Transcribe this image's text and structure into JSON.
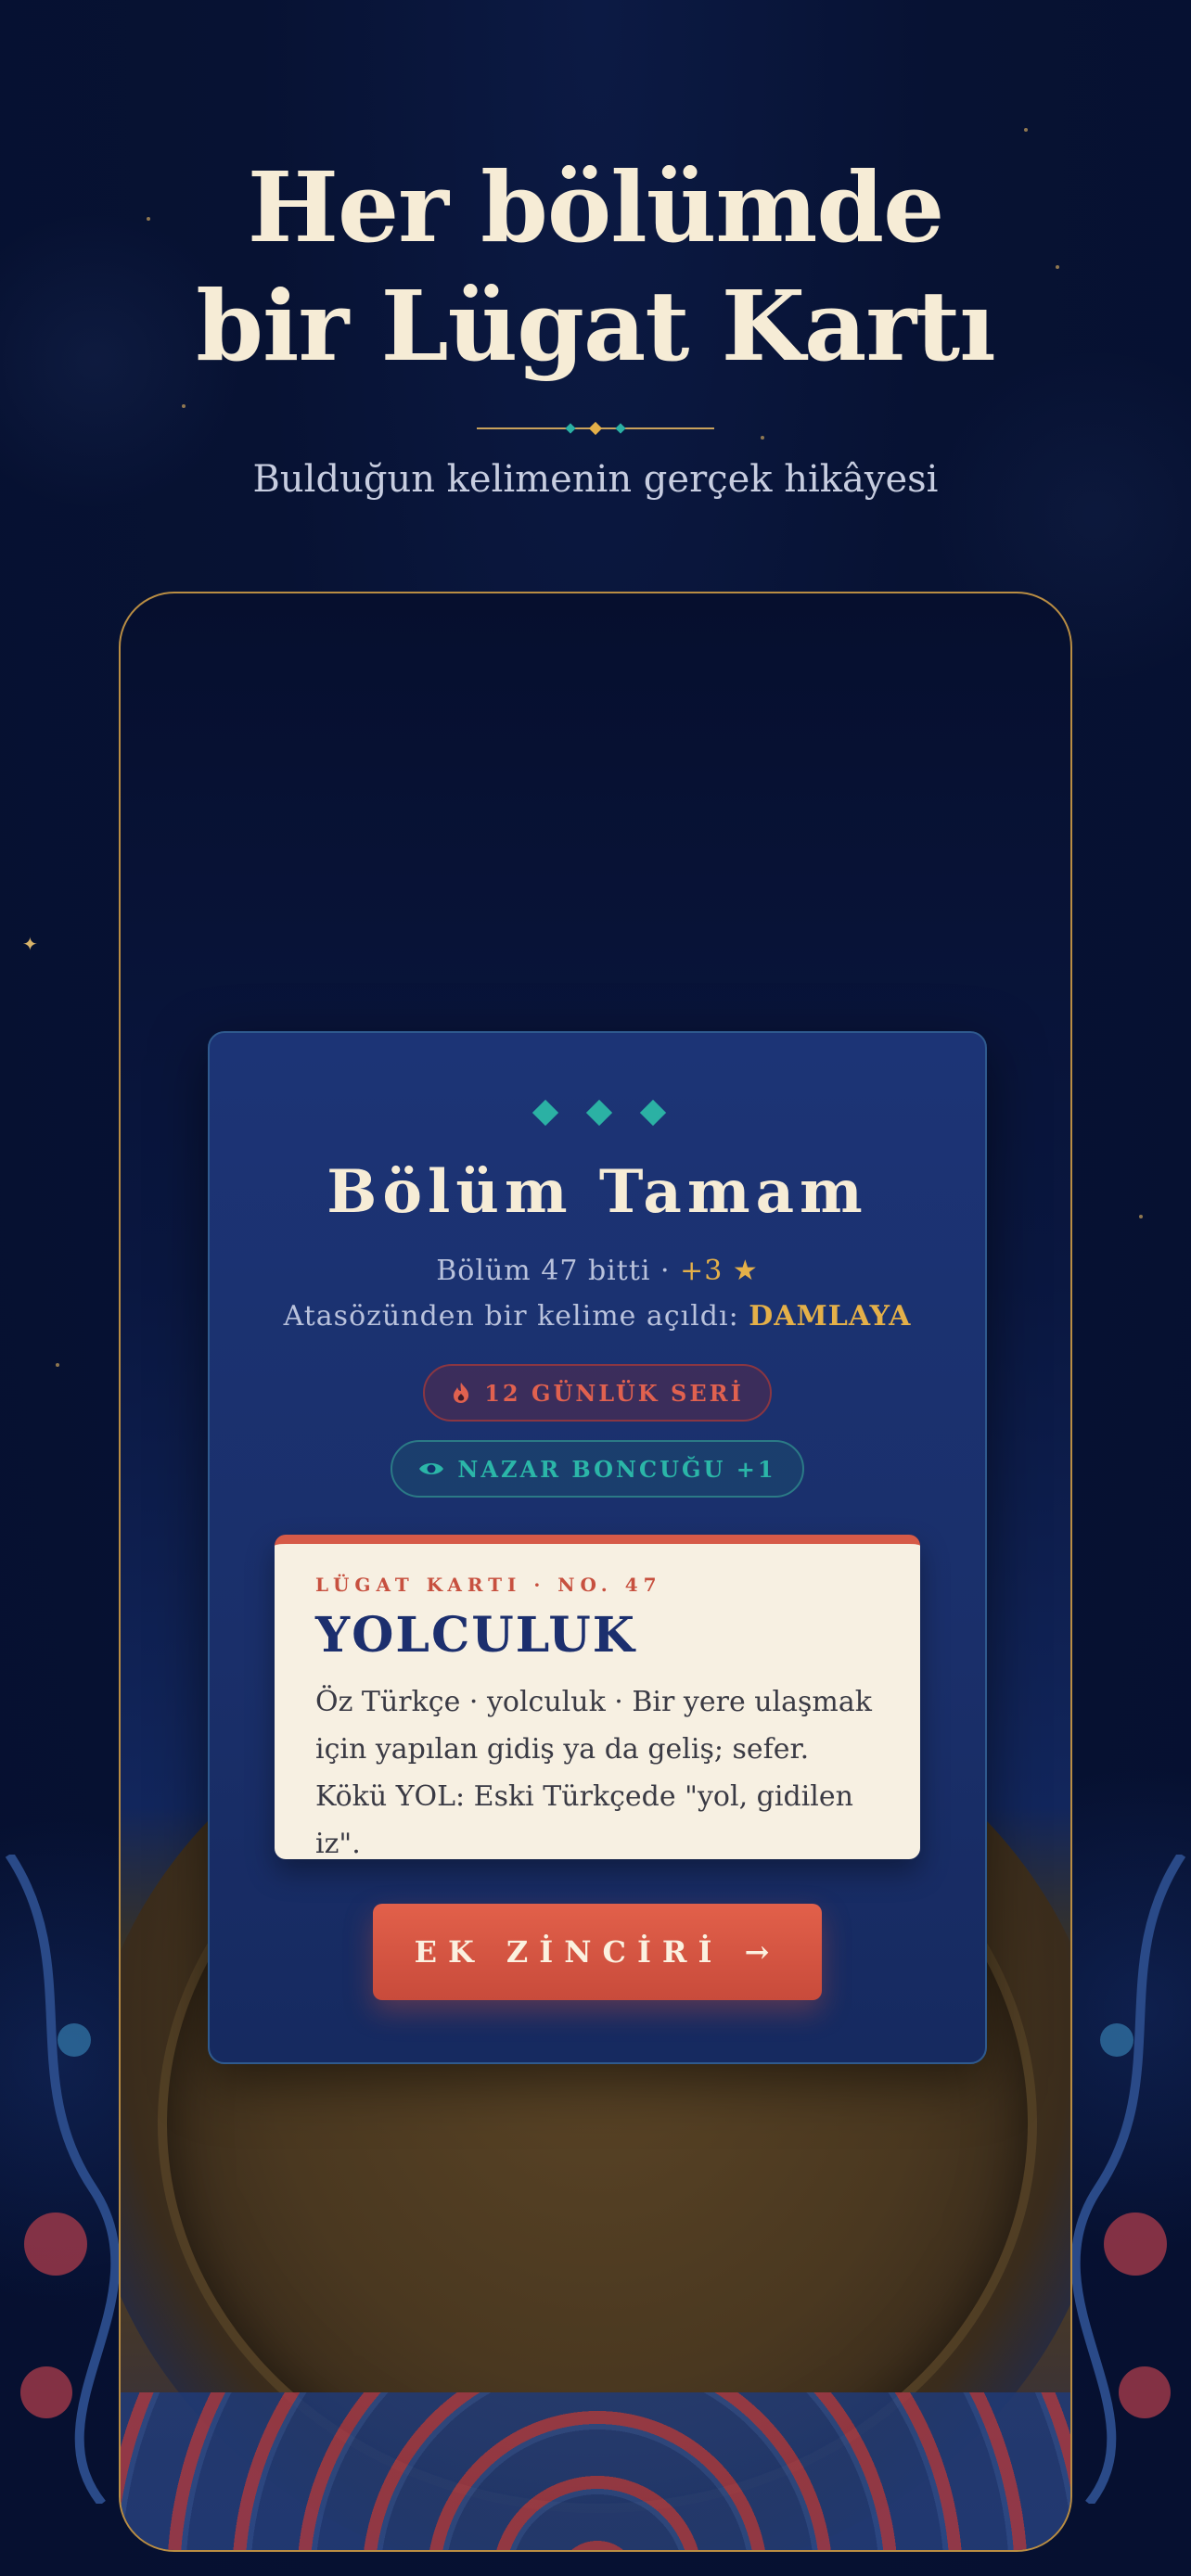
{
  "hero": {
    "title_line1": "Her bölümde",
    "title_line2": "bir Lügat Kartı",
    "subtitle": "Bulduğun kelimenin gerçek hikâyesi"
  },
  "card": {
    "title": "Bölüm Tamam",
    "chapter_text": "Bölüm 47 bitti · ",
    "star_reward": "+3 ★",
    "unlock_text": "Atasözünden bir kelime açıldı: ",
    "unlock_word": "DAMLAYA",
    "streak_label": "12 GÜNLÜK SERİ",
    "nazar_label": "NAZAR BONCUĞU +1"
  },
  "lugat": {
    "label": "LÜGAT KARTI · NO. 47",
    "word": "YOLCULUK",
    "definition": "Öz Türkçe · yolculuk · Bir yere ulaşmak için yapılan gidiş ya da geliş; sefer. Kökü YOL: Eski Türkçede \"yol, gidilen iz\"."
  },
  "cta": {
    "label": "EK ZİNCİRİ →"
  },
  "icons": {
    "streak": "flame-icon",
    "nazar": "eye-icon"
  },
  "colors": {
    "gold": "#e4b049",
    "teal": "#2bb1a4",
    "coral": "#d65a48",
    "navy": "#1c2f6e",
    "cream": "#f7f0e2"
  }
}
